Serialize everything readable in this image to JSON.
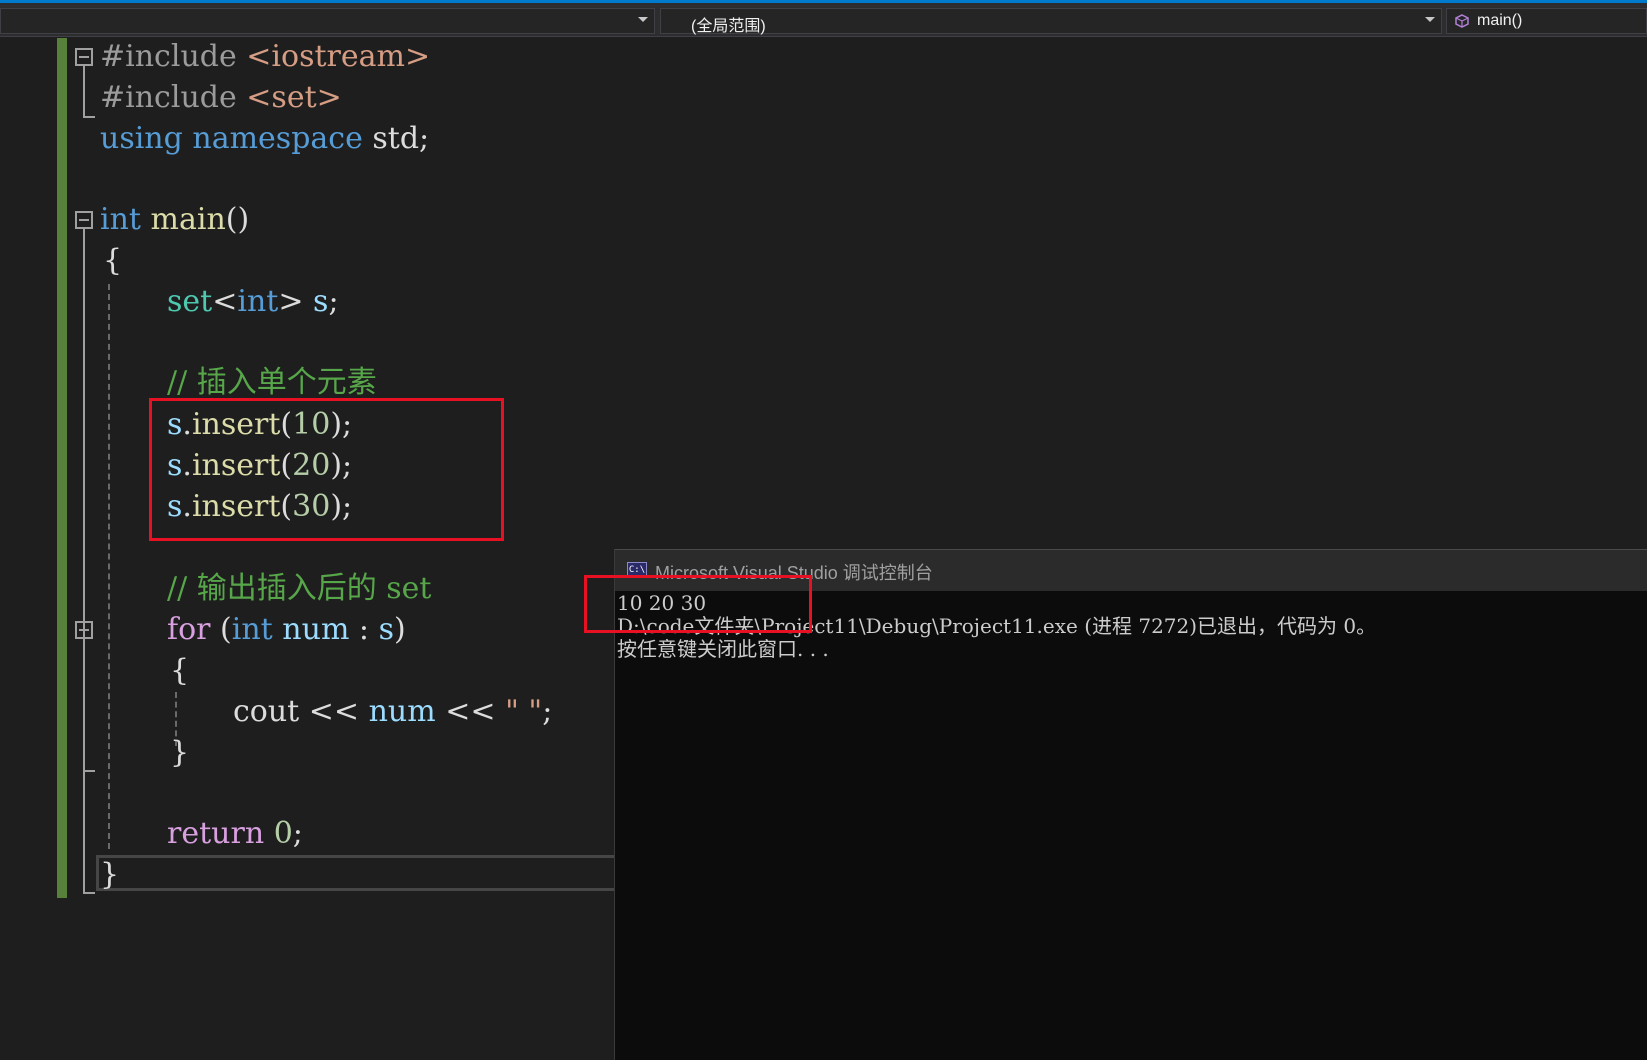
{
  "navbar": {
    "scope": "(全局范围)",
    "member": "main()"
  },
  "code": {
    "l1_pp": "#include",
    "l1_hdr": "<iostream>",
    "l2_pp": "#include",
    "l2_hdr": "<set>",
    "l3_kw1": "using",
    "l3_kw2": "namespace",
    "l3_id": "std;",
    "l5_kw": "int",
    "l5_fn": "main",
    "l5_paren": "()",
    "l6": "{",
    "l7_type": "set",
    "l7_lt": "<",
    "l7_kw": "int",
    "l7_gt": ">",
    "l7_var": "s",
    "l7_semi": ";",
    "l9_comment": "// 插入单个元素",
    "l10_var": "s",
    "l10_dot": ".",
    "l10_fn": "insert",
    "l10_open": "(",
    "l10_num": "10",
    "l10_close": ");",
    "l11_var": "s",
    "l11_dot": ".",
    "l11_fn": "insert",
    "l11_open": "(",
    "l11_num": "20",
    "l11_close": ");",
    "l12_var": "s",
    "l12_dot": ".",
    "l12_fn": "insert",
    "l12_open": "(",
    "l12_num": "30",
    "l12_close": ");",
    "l14_comment": "// 输出插入后的 set",
    "l15_kw": "for",
    "l15_open": " (",
    "l15_type": "int",
    "l15_var": "num",
    "l15_colon": " : ",
    "l15_var2": "s",
    "l15_close": ")",
    "l16": "{",
    "l17_id": "cout",
    "l17_op1": " << ",
    "l17_var": "num",
    "l17_op2": " << ",
    "l17_str": "\" \"",
    "l17_semi": ";",
    "l18": "}",
    "l20_kw": "return",
    "l20_num": "0",
    "l20_semi": ";",
    "l21": "}"
  },
  "console": {
    "title": "Microsoft Visual Studio 调试控制台",
    "icon_text": "C:\\",
    "lines": [
      "10 20 30",
      "D:\\code文件夹\\Project11\\Debug\\Project11.exe (进程 7272)已退出，代码为 0。",
      "按任意键关闭此窗口. . ."
    ]
  },
  "colors": {
    "keyword": "#569cd6",
    "control": "#d8a0df",
    "type": "#4ec9b0",
    "function": "#dcdcaa",
    "variable": "#9cdcfe",
    "comment": "#57a64a",
    "number": "#b5cea8",
    "string": "#d69d85",
    "highlight": "#e81123"
  }
}
